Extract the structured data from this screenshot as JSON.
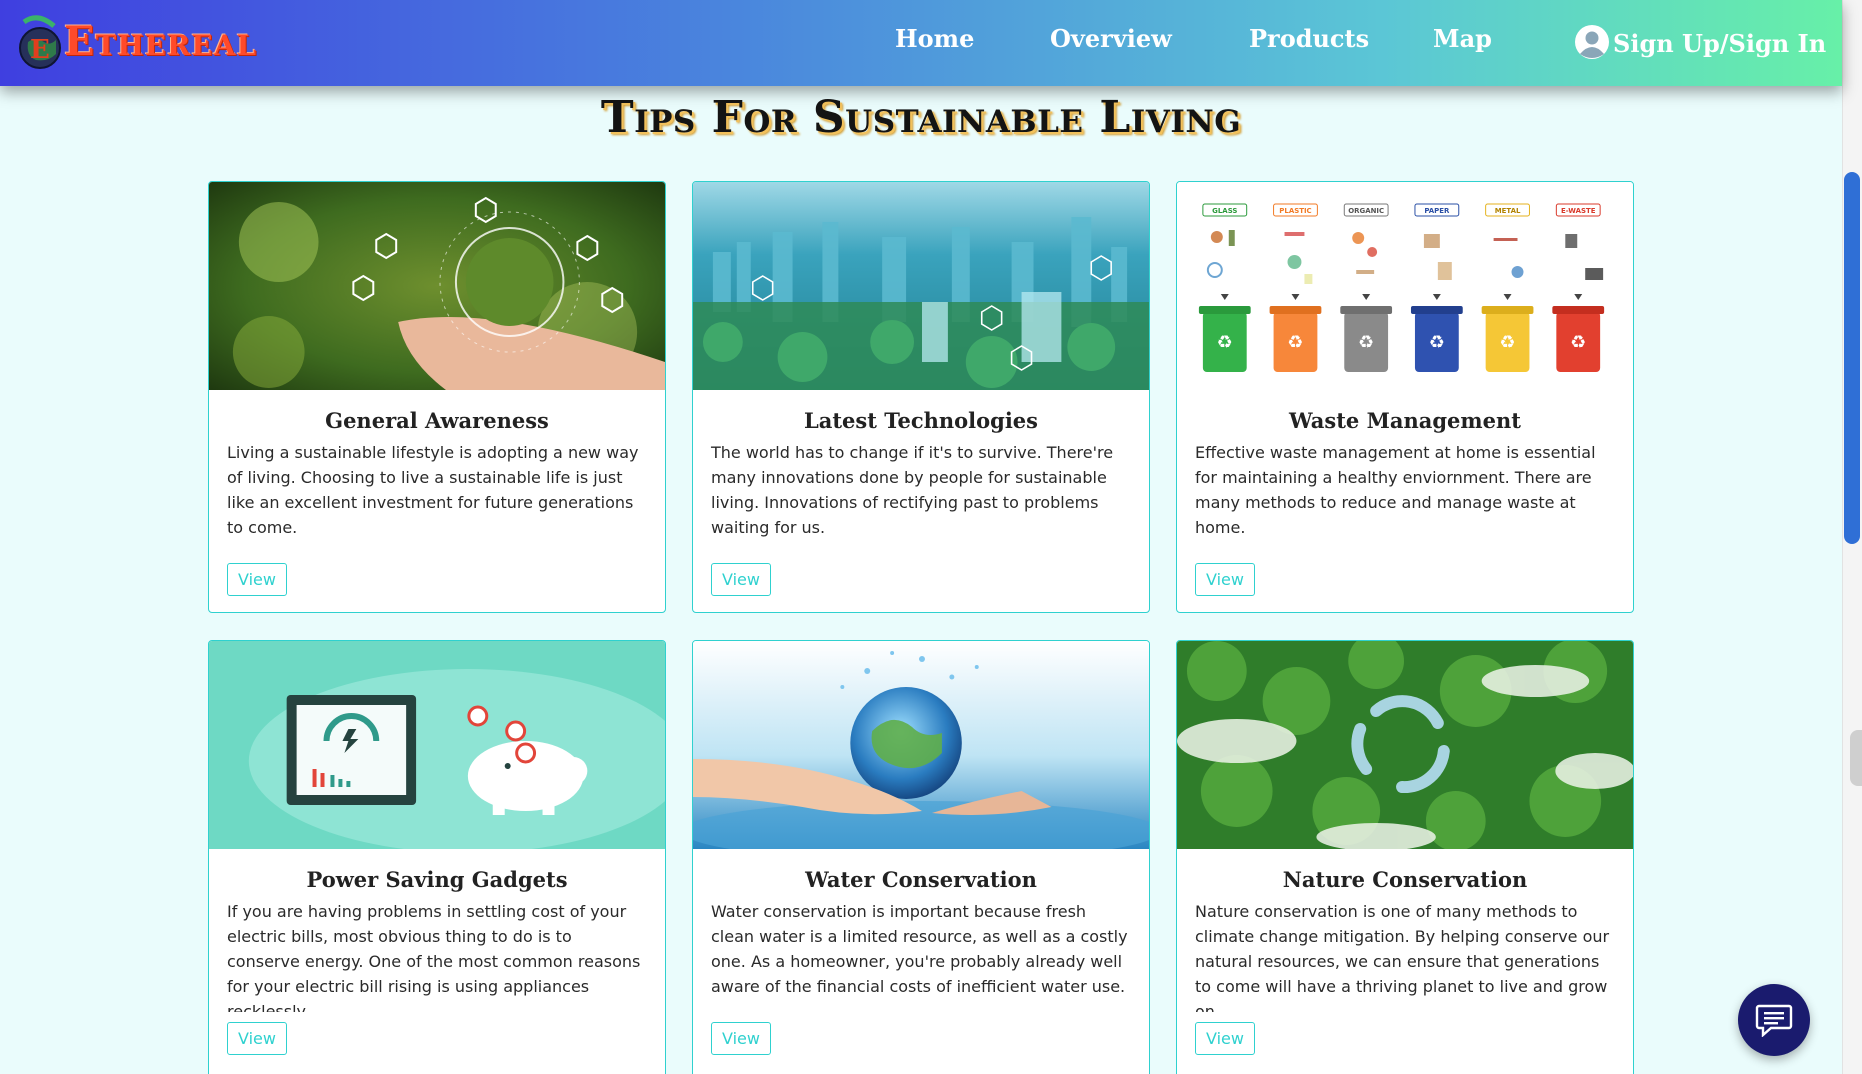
{
  "brand": {
    "name": "Ethereal"
  },
  "nav": {
    "items": [
      "Home",
      "Overview",
      "Products",
      "Map"
    ],
    "signin": "Sign Up/Sign In"
  },
  "page": {
    "title": "Tips For Sustainable Living"
  },
  "cards": [
    {
      "title": "General Awareness",
      "text": "Living a sustainable lifestyle is adopting a new way of living. Choosing to live a sustainable life is just like an excellent investment for future generations to come.",
      "button": "View"
    },
    {
      "title": "Latest Technologies",
      "text": "The world has to change if it's to survive. There're many innovations done by people for sustainable living. Innovations of rectifying past to problems waiting for us.",
      "button": "View"
    },
    {
      "title": "Waste Management",
      "text": "Effective waste management at home is essential for maintaining a healthy enviornment. There are many methods to reduce and manage waste at home.",
      "button": "View",
      "bin_labels": [
        "GLASS",
        "PLASTIC",
        "ORGANIC",
        "PAPER",
        "METAL",
        "E-WASTE"
      ]
    },
    {
      "title": "Power Saving Gadgets",
      "text": "If you are having problems in settling cost of your electric bills, most obvious thing to do is to conserve energy. One of the most common reasons for your electric bill rising is using appliances recklessly.",
      "button": "View"
    },
    {
      "title": "Water Conservation",
      "text": "Water conservation is important because fresh clean water is a limited resource, as well as a costly one. As a homeowner, you're probably already well aware of the financial costs of inefficient water use.",
      "button": "View"
    },
    {
      "title": "Nature Conservation",
      "text": "Nature conservation is one of many methods to climate change mitigation. By helping conserve our natural resources, we can ensure that generations to come will have a thriving planet to live and grow on.",
      "button": "View"
    }
  ],
  "colors": {
    "accent": "#2fd1cf",
    "brand": "#ff4a2a",
    "chat": "#1a1b6e"
  },
  "icons": {
    "user": "user-circle-icon",
    "chat": "chat-icon"
  }
}
